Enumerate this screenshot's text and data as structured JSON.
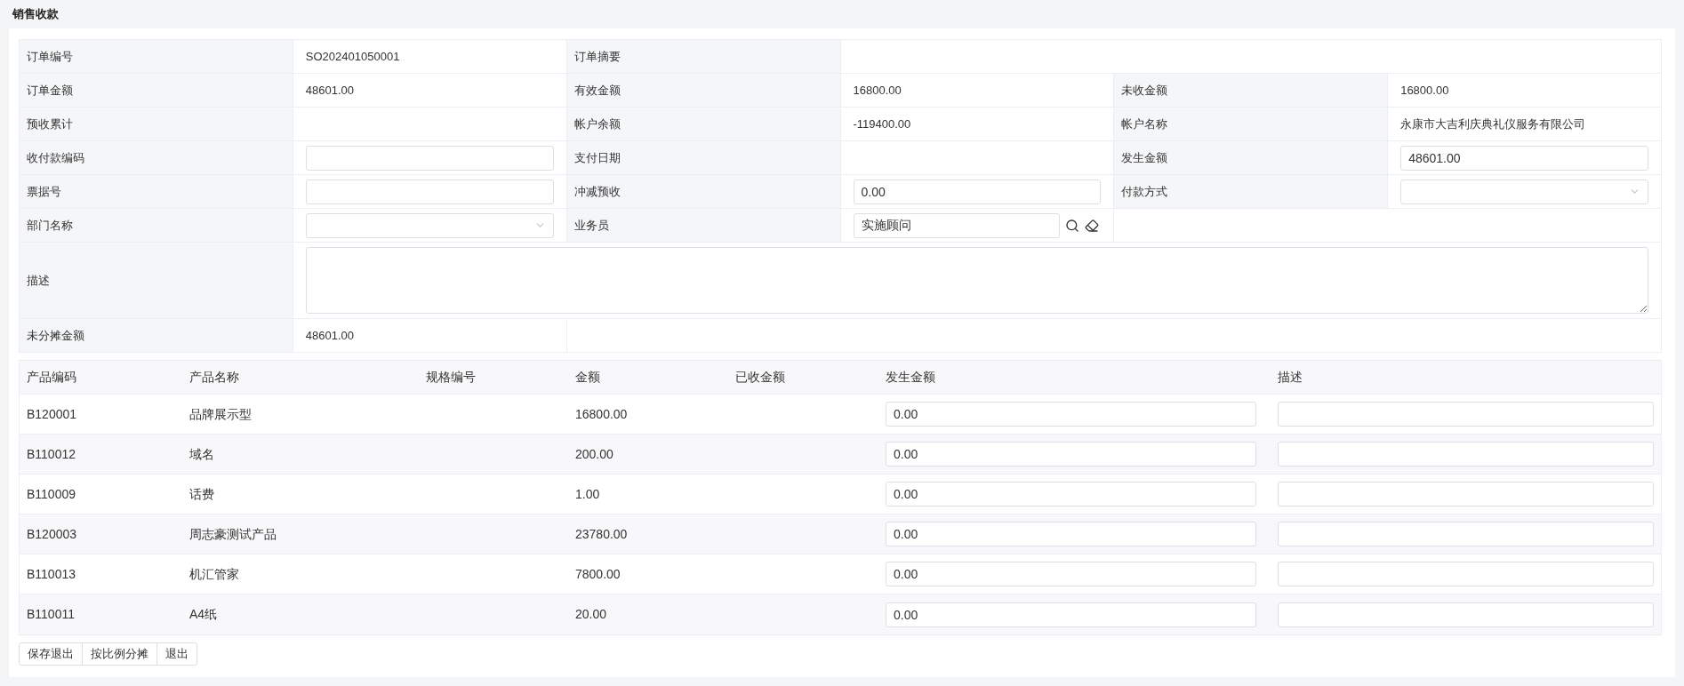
{
  "title": "销售收款",
  "form": {
    "rows": [
      [
        {
          "kind": "label",
          "text": "订单编号"
        },
        {
          "kind": "value",
          "text": "SO202401050001"
        },
        {
          "kind": "label",
          "text": "订单摘要"
        },
        {
          "kind": "value"
        }
      ],
      [
        {
          "kind": "label",
          "text": "订单金额"
        },
        {
          "kind": "value",
          "text": "48601.00"
        },
        {
          "kind": "label",
          "text": "有效金额"
        },
        {
          "kind": "value",
          "text": "16800.00"
        },
        {
          "kind": "label",
          "text": "未收金额"
        },
        {
          "kind": "value",
          "text": "16800.00"
        }
      ],
      [
        {
          "kind": "label",
          "text": "预收累计"
        },
        {
          "kind": "value"
        },
        {
          "kind": "label",
          "text": "帐户余额"
        },
        {
          "kind": "value",
          "text": "-119400.00"
        },
        {
          "kind": "label",
          "text": "帐户名称"
        },
        {
          "kind": "value",
          "text": "永康市大吉利庆典礼仪服务有限公司"
        }
      ],
      [
        {
          "kind": "label",
          "text": "收付款编码"
        },
        {
          "kind": "input"
        },
        {
          "kind": "label",
          "text": "支付日期"
        },
        {
          "kind": "value"
        },
        {
          "kind": "label",
          "text": "发生金额"
        },
        {
          "kind": "input",
          "value": "48601.00"
        }
      ],
      [
        {
          "kind": "label",
          "text": "票据号"
        },
        {
          "kind": "input"
        },
        {
          "kind": "label",
          "text": "冲减预收"
        },
        {
          "kind": "input",
          "value": "0.00"
        },
        {
          "kind": "label",
          "text": "付款方式"
        },
        {
          "kind": "select"
        }
      ],
      [
        {
          "kind": "label",
          "text": "部门名称"
        },
        {
          "kind": "select"
        },
        {
          "kind": "label",
          "text": "业务员"
        },
        {
          "kind": "lookup",
          "value": "实施顾问"
        },
        {
          "kind": "value"
        }
      ],
      [
        {
          "kind": "label",
          "text": "描述"
        },
        {
          "kind": "textarea"
        }
      ],
      [
        {
          "kind": "label",
          "text": "未分摊金额"
        },
        {
          "kind": "value",
          "text": "48601.00"
        },
        {
          "kind": "value"
        }
      ]
    ]
  },
  "table": {
    "columns": [
      "产品编码",
      "产品名称",
      "规格编号",
      "金额",
      "已收金额",
      "发生金额",
      "描述"
    ],
    "rows": [
      {
        "code": "B120001",
        "name": "品牌展示型",
        "amount": "16800.00",
        "occurred": "0.00"
      },
      {
        "code": "B110012",
        "name": "域名",
        "amount": "200.00",
        "occurred": "0.00"
      },
      {
        "code": "B110009",
        "name": "话费",
        "amount": "1.00",
        "occurred": "0.00"
      },
      {
        "code": "B120003",
        "name": "周志豪测试产品",
        "amount": "23780.00",
        "occurred": "0.00"
      },
      {
        "code": "B110013",
        "name": "机汇管家",
        "amount": "7800.00",
        "occurred": "0.00"
      },
      {
        "code": "B110011",
        "name": "A4纸",
        "amount": "20.00",
        "occurred": "0.00"
      }
    ]
  },
  "buttons": [
    "保存退出",
    "按比例分摊",
    "退出"
  ]
}
